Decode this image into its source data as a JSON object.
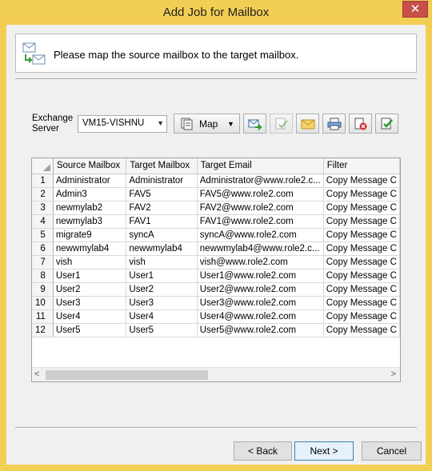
{
  "window": {
    "title": "Add Job for Mailbox",
    "close_glyph": "✕"
  },
  "banner": {
    "text": "Please map the source mailbox to the target mailbox.",
    "icon": "mailbox-mapping-icon"
  },
  "server": {
    "label_line1": "Exchange",
    "label_line2": "Server",
    "selected": "VM15-VISHNU"
  },
  "toolbar": {
    "map_label": "Map"
  },
  "grid": {
    "columns": [
      "Source Mailbox",
      "Target Mailbox",
      "Target Email",
      "Filter"
    ],
    "rows": [
      {
        "n": "1",
        "src": "Administrator",
        "tgt": "Administrator",
        "email": "Administrator@www.role2.c...",
        "filter": "Copy Message C"
      },
      {
        "n": "2",
        "src": "Admin3",
        "tgt": "FAV5",
        "email": "FAV5@www.role2.com",
        "filter": "Copy Message C"
      },
      {
        "n": "3",
        "src": "newmylab2",
        "tgt": "FAV2",
        "email": "FAV2@www.role2.com",
        "filter": "Copy Message C"
      },
      {
        "n": "4",
        "src": "newmylab3",
        "tgt": "FAV1",
        "email": "FAV1@www.role2.com",
        "filter": "Copy Message C"
      },
      {
        "n": "5",
        "src": "migrate9",
        "tgt": "syncA",
        "email": "syncA@www.role2.com",
        "filter": "Copy Message C"
      },
      {
        "n": "6",
        "src": "newwmylab4",
        "tgt": "newwmylab4",
        "email": "newwmylab4@www.role2.c...",
        "filter": "Copy Message C"
      },
      {
        "n": "7",
        "src": "vish",
        "tgt": "vish",
        "email": "vish@www.role2.com",
        "filter": "Copy Message C"
      },
      {
        "n": "8",
        "src": "User1",
        "tgt": "User1",
        "email": "User1@www.role2.com",
        "filter": "Copy Message C"
      },
      {
        "n": "9",
        "src": "User2",
        "tgt": "User2",
        "email": "User2@www.role2.com",
        "filter": "Copy Message C"
      },
      {
        "n": "10",
        "src": "User3",
        "tgt": "User3",
        "email": "User3@www.role2.com",
        "filter": "Copy Message C"
      },
      {
        "n": "11",
        "src": "User4",
        "tgt": "User4",
        "email": "User4@www.role2.com",
        "filter": "Copy Message C"
      },
      {
        "n": "12",
        "src": "User5",
        "tgt": "User5",
        "email": "User5@www.role2.com",
        "filter": "Copy Message C"
      }
    ]
  },
  "footer": {
    "back": "< Back",
    "next": "Next >",
    "cancel": "Cancel"
  }
}
